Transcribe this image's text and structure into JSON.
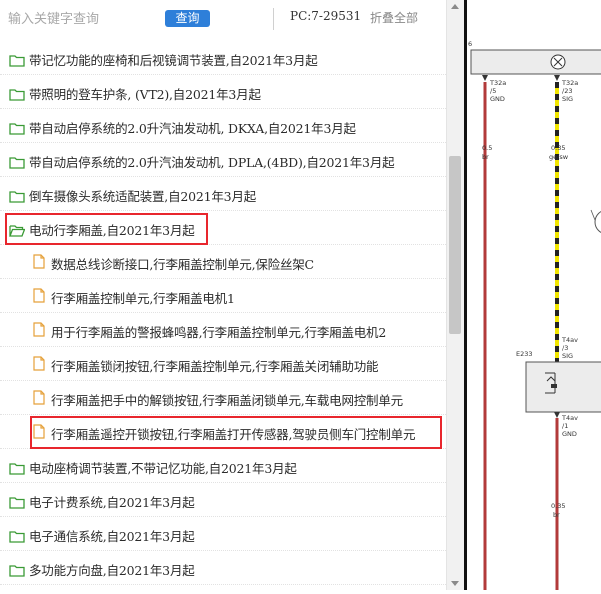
{
  "toolbar": {
    "search_placeholder": "输入关键字查询",
    "query_label": "查询",
    "pc_code": "PC:7-29531",
    "collapse_label": "折叠全部"
  },
  "tree": {
    "items": [
      {
        "type": "folder",
        "label": "带记忆功能的座椅和后视镜调节装置,自2021年3月起"
      },
      {
        "type": "folder",
        "label": "带照明的登车护条, (VT2),自2021年3月起"
      },
      {
        "type": "folder",
        "label": "带自动启停系统的2.0升汽油发动机, DKXA,自2021年3月起"
      },
      {
        "type": "folder",
        "label": "带自动启停系统的2.0升汽油发动机, DPLA,(4BD),自2021年3月起"
      },
      {
        "type": "folder",
        "label": "倒车摄像头系统适配装置,自2021年3月起"
      },
      {
        "type": "folder-open",
        "label": "电动行李厢盖,自2021年3月起"
      },
      {
        "type": "file",
        "label": "数据总线诊断接口,行李厢盖控制单元,保险丝架C"
      },
      {
        "type": "file",
        "label": "行李厢盖控制单元,行李厢盖电机1"
      },
      {
        "type": "file",
        "label": "用于行李厢盖的警报蜂鸣器,行李厢盖控制单元,行李厢盖电机2"
      },
      {
        "type": "file",
        "label": "行李厢盖锁闭按钮,行李厢盖控制单元,行李厢盖关闭辅助功能"
      },
      {
        "type": "file",
        "label": "行李厢盖把手中的解锁按钮,行李厢盖闭锁单元,车载电网控制单元"
      },
      {
        "type": "file",
        "label": "行李厢盖遥控开锁按钮,行李厢盖打开传感器,驾驶员侧车门控制单元"
      },
      {
        "type": "folder",
        "label": "电动座椅调节装置,不带记忆功能,自2021年3月起"
      },
      {
        "type": "folder",
        "label": "电子计费系统,自2021年3月起"
      },
      {
        "type": "folder",
        "label": "电子通信系统,自2021年3月起"
      },
      {
        "type": "folder",
        "label": "多功能方向盘,自2021年3月起"
      }
    ]
  },
  "diagram": {
    "corner_label": "6",
    "pin_left": {
      "connector": "T32a",
      "pin": "/5",
      "signal": "GND"
    },
    "pin_right": {
      "connector": "T32a",
      "pin": "/23",
      "signal": "SIG"
    },
    "wire_left": {
      "size": "0.5",
      "color": "br"
    },
    "wire_right": {
      "size": "0.35",
      "color": "ge/sw"
    },
    "component": "E233",
    "pin_comp_top": {
      "connector": "T4av",
      "pin": "/3",
      "signal": "SIG"
    },
    "pin_comp_bottom": {
      "connector": "T4av",
      "pin": "/1",
      "signal": "GND"
    },
    "wire_bottom": {
      "size": "0.35",
      "color": "br"
    },
    "colors": {
      "wire_brown": "#b23a3a",
      "wire_yellow": "#f2e600",
      "wire_black": "#222222"
    }
  }
}
